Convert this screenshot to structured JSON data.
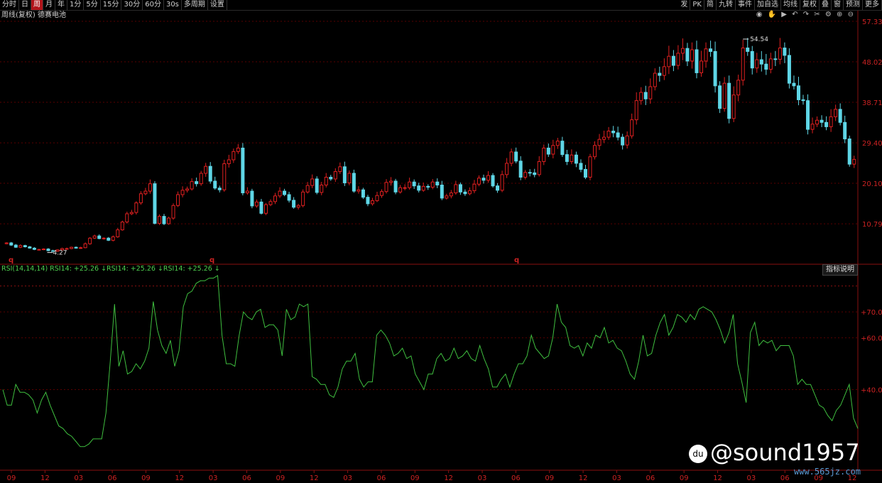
{
  "toolbar": {
    "left_items": [
      {
        "label": "分时",
        "icon": "arrow-left-icon"
      },
      {
        "label": "日"
      },
      {
        "label": "周",
        "active": true
      },
      {
        "label": "月"
      },
      {
        "label": "年"
      },
      {
        "label": "1分"
      },
      {
        "label": "5分"
      },
      {
        "label": "15分"
      },
      {
        "label": "30分"
      },
      {
        "label": "60分"
      },
      {
        "label": "30s"
      },
      {
        "label": "多周期"
      },
      {
        "label": "设置"
      }
    ],
    "right_items": [
      {
        "label": "发"
      },
      {
        "label": "PK"
      },
      {
        "label": "简"
      },
      {
        "label": "九转"
      },
      {
        "label": "事件"
      },
      {
        "label": "加自选"
      },
      {
        "label": "均线"
      },
      {
        "label": "复权"
      },
      {
        "label": "叠"
      },
      {
        "label": "窗"
      },
      {
        "label": "预测"
      },
      {
        "label": "更多"
      }
    ]
  },
  "chart_title": "周线(复权) 德赛电池",
  "price_high_label": "54.54",
  "price_low_label": "4.27",
  "q_markers": [
    "q",
    "q",
    "q"
  ],
  "rsi": {
    "legend": "RSI(14,14,14) RSI14: +25.26 ↓RSI14: +25.26 ↓RSI14: +25.26 ↓",
    "help_button": "指标说明"
  },
  "watermark": "@sound1957",
  "site": "www.565jz.com",
  "colors": {
    "up": "#e02020",
    "down": "#5fd6e6",
    "rsi": "#3fbf3f",
    "grid": "#5a0000",
    "axis": "#cc2222"
  },
  "chart_data": [
    {
      "type": "candlestick",
      "title": "周线(复权) 德赛电池",
      "y_ticks": [
        57.33,
        48.02,
        38.71,
        29.4,
        20.1,
        10.79
      ],
      "ylim": [
        1.5,
        57.33
      ],
      "annotations": [
        {
          "label": "54.54",
          "kind": "max"
        },
        {
          "label": "4.27",
          "kind": "min"
        }
      ],
      "series": [
        {
          "values": [
            6.4,
            5.9,
            5.4,
            5.8,
            5.5,
            5.2,
            4.9,
            4.9,
            5.0,
            4.6,
            4.5,
            4.8,
            5.1,
            5.1,
            5.4,
            5.2,
            5.3,
            6.2,
            7.5,
            8.0,
            7.4,
            7.5,
            7.0,
            7.8,
            9.4,
            11.2,
            13.1,
            13.4,
            15.6,
            17.7,
            18.3,
            20.0,
            10.9,
            12.5,
            10.8,
            12.1,
            15.0,
            17.5,
            18.5,
            18.8,
            20.5,
            20.0,
            22.4,
            24.0,
            20.6,
            19.0,
            18.6,
            24.6,
            25.5,
            27.4,
            28.2,
            17.9,
            18.3,
            14.9,
            15.8,
            13.2,
            15.2,
            15.9,
            17.2,
            18.3,
            17.5,
            16.2,
            14.6,
            15.0,
            18.1,
            19.6,
            21.1,
            18.0,
            19.7,
            21.5,
            21.1,
            22.8,
            23.9,
            20.2,
            22.4,
            18.3,
            18.6,
            16.9,
            15.4,
            16.1,
            17.3,
            18.2,
            20.3,
            20.6,
            18.1,
            19.1,
            19.1,
            20.4,
            19.5,
            18.5,
            19.4,
            19.2,
            20.4,
            19.7,
            16.7,
            17.2,
            17.9,
            19.8,
            18.1,
            17.7,
            18.4,
            19.9,
            21.3,
            20.8,
            21.9,
            19.5,
            18.5,
            22.1,
            24.7,
            27.3,
            25.2,
            21.5,
            22.6,
            22.5,
            22.1,
            25.1,
            28.2,
            26.8,
            28.8,
            29.8,
            26.7,
            25.1,
            26.6,
            24.7,
            23.3,
            21.5,
            26.2,
            28.8,
            30.2,
            30.7,
            32.1,
            31.7,
            30.7,
            28.9,
            31.0,
            34.7,
            39.1,
            41.0,
            39.5,
            42.3,
            45.4,
            44.9,
            46.9,
            49.3,
            47.2,
            50.0,
            51.1,
            48.2,
            50.8,
            45.5,
            48.2,
            51.0,
            50.4,
            42.5,
            37.3,
            43.1,
            35.0,
            40.4,
            43.8,
            51.2,
            50.4,
            46.6,
            48.5,
            47.5,
            46.3,
            48.7,
            48.6,
            51.2,
            49.5,
            43.1,
            42.5,
            39.3,
            39.1,
            32.5,
            33.7,
            34.6,
            34.1,
            33.1,
            35.4,
            37.1,
            34.1,
            30.3,
            24.5,
            25.6
          ]
        }
      ]
    },
    {
      "type": "line",
      "title": "RSI(14,14,14)",
      "y_ticks": [
        70.0,
        60.0,
        40.0
      ],
      "ylim": [
        10,
        80
      ],
      "x_tick_labels": [
        "09",
        "12",
        "03",
        "06",
        "09",
        "12",
        "03",
        "06",
        "09",
        "12",
        "03",
        "06",
        "09",
        "12",
        "03",
        "06",
        "09",
        "12",
        "03",
        "06",
        "09",
        "12",
        "03",
        "06",
        "09",
        "12"
      ],
      "series": [
        {
          "name": "RSI14",
          "values": [
            40,
            34,
            34,
            42,
            39,
            39,
            38,
            36,
            31,
            36,
            39,
            34,
            30,
            26,
            25,
            23,
            22,
            20,
            18,
            18,
            19,
            21,
            21,
            21,
            31,
            51,
            73,
            49,
            55,
            46,
            47,
            50,
            48,
            51,
            56,
            74,
            63,
            57,
            54,
            59,
            49,
            55,
            72,
            77,
            78,
            81,
            82,
            82,
            83,
            83,
            84,
            61,
            50,
            50,
            49,
            61,
            70,
            68,
            67,
            70,
            71,
            64,
            65,
            65,
            63,
            53,
            71,
            67,
            68,
            73,
            72,
            73,
            45,
            44,
            42,
            42,
            38,
            37,
            41,
            48,
            51,
            51,
            54,
            44,
            41,
            43,
            43,
            61,
            63,
            61,
            58,
            53,
            54,
            56,
            52,
            53,
            46,
            43,
            40,
            46,
            46,
            52,
            54,
            51,
            52,
            56,
            52,
            53,
            55,
            52,
            51,
            57,
            52,
            48,
            41,
            41,
            44,
            46,
            41,
            46,
            50,
            50,
            53,
            61,
            56,
            54,
            52,
            53,
            60,
            73,
            66,
            64,
            57,
            56,
            57,
            53,
            58,
            56,
            61,
            60,
            64,
            58,
            59,
            56,
            55,
            51,
            46,
            44,
            51,
            61,
            53,
            54,
            61,
            66,
            69,
            61,
            64,
            69,
            68,
            66,
            69,
            67,
            71,
            72,
            71,
            70,
            67,
            63,
            58,
            62,
            69,
            50,
            43,
            35,
            62,
            66,
            57,
            59,
            58,
            59,
            55,
            57,
            57,
            57,
            53,
            42,
            44,
            42,
            42,
            38,
            34,
            33,
            30,
            28,
            32,
            34,
            38,
            42,
            29,
            25
          ]
        }
      ]
    }
  ]
}
